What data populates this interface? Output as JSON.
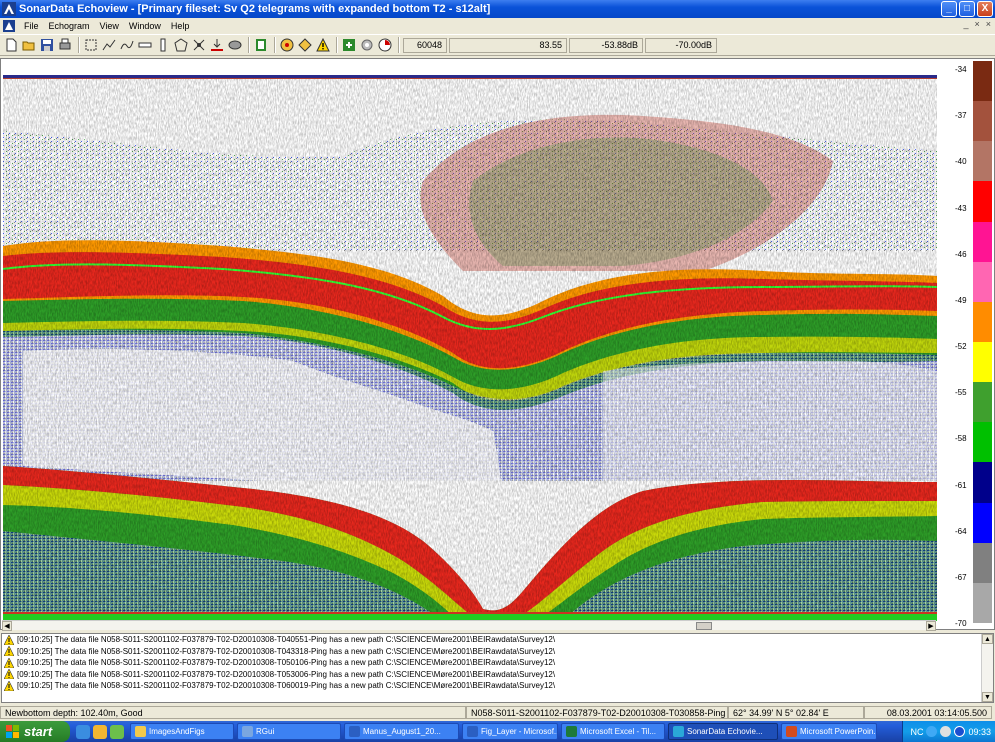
{
  "window": {
    "title": "SonarData Echoview - [Primary fileset: Sv Q2 telegrams with expanded bottom T2 - s12alt]",
    "buttons": [
      "_",
      "□",
      "X"
    ]
  },
  "menu": {
    "items": [
      "File",
      "Echogram",
      "View",
      "Window",
      "Help"
    ],
    "mdi_buttons": [
      "_",
      "×",
      "×"
    ]
  },
  "toolbar": {
    "icons": [
      "new-icon",
      "open-icon",
      "save-icon",
      "print-icon",
      "select-rect-icon",
      "polyline-icon",
      "line-icon",
      "bar-icon",
      "column-icon",
      "polygon-icon",
      "cursor-icon",
      "bottom-pick-icon",
      "region-icon",
      "layer-icon",
      "properties-icon",
      "zoom-icon",
      "warning-icon",
      "export-icon",
      "settings-icon",
      "report-icon"
    ],
    "readouts": {
      "ping": "60048",
      "depth": "83.55",
      "sv": "-53.88dB",
      "threshold": "-70.00dB"
    }
  },
  "color_scale": {
    "labels": [
      "-34",
      "-37",
      "-40",
      "-43",
      "-46",
      "-49",
      "-52",
      "-55",
      "-58",
      "-61",
      "-64",
      "-67",
      "-70"
    ],
    "colors": [
      "#7a2a12",
      "#a3523d",
      "#b37565",
      "#ff0000",
      "#ff1493",
      "#ff66b2",
      "#ff8c00",
      "#ffff00",
      "#3fa02e",
      "#00c000",
      "#00008b",
      "#0000ff",
      "#808080",
      "#a8a8a8"
    ]
  },
  "messages": [
    "[09:10:25] The data file N058-S011-S2001102-F037879-T02-D20010308-T040551-Ping has a new path C:\\SCIENCE\\Møre2001\\BEIRawdata\\Survey12\\",
    "[09:10:25] The data file N058-S011-S2001102-F037879-T02-D20010308-T043318-Ping has a new path C:\\SCIENCE\\Møre2001\\BEIRawdata\\Survey12\\",
    "[09:10:25] The data file N058-S011-S2001102-F037879-T02-D20010308-T050106-Ping has a new path C:\\SCIENCE\\Møre2001\\BEIRawdata\\Survey12\\",
    "[09:10:25] The data file N058-S011-S2001102-F037879-T02-D20010308-T053006-Ping has a new path C:\\SCIENCE\\Møre2001\\BEIRawdata\\Survey12\\",
    "[09:10:25] The data file N058-S011-S2001102-F037879-T02-D20010308-T060019-Ping has a new path C:\\SCIENCE\\Møre2001\\BEIRawdata\\Survey12\\"
  ],
  "status": {
    "bottom": "Newbottom depth: 102.40m, Good",
    "file": "N058-S011-S2001102-F037879-T02-D20010308-T030858-Ping",
    "position": "62° 34.99' N 5° 02.84' E",
    "datetime": "08.03.2001 03:14:05.500"
  },
  "taskbar": {
    "start": "start",
    "tasks": [
      {
        "label": "ImagesAndFigs",
        "color": "#f2c94c"
      },
      {
        "label": "RGui",
        "color": "#7aa6e0"
      },
      {
        "label": "Manus_August1_20...",
        "color": "#2b5fc2"
      },
      {
        "label": "Fig_Layer - Microsof...",
        "color": "#2b5fc2"
      },
      {
        "label": "Microsoft Excel - Til...",
        "color": "#1d7a3a"
      },
      {
        "label": "SonarData Echovie...",
        "color": "#2aa8d8"
      },
      {
        "label": "Microsoft PowerPoin...",
        "color": "#d24b1f"
      }
    ],
    "tray_text": "NC",
    "clock": "09:33"
  }
}
